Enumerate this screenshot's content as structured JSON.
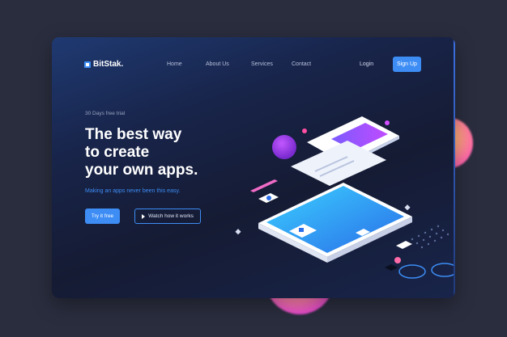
{
  "brand": {
    "name": "BitStak."
  },
  "nav": {
    "links": [
      "Home",
      "About Us",
      "Services",
      "Contact"
    ],
    "login": "Login",
    "signup": "Sign Up"
  },
  "hero": {
    "trial": "30 Days free trial",
    "headline": [
      "The best way",
      "to create",
      "your own apps."
    ],
    "subtitle": "Making an apps never been this easy.",
    "cta_primary": "Try it free",
    "cta_secondary": "Watch how it works"
  },
  "colors": {
    "accent": "#3d8df5",
    "background": "#2a2d3e",
    "card": "#151b33"
  },
  "icons": [
    "logo-icon",
    "play-icon",
    "phone-illustration"
  ]
}
